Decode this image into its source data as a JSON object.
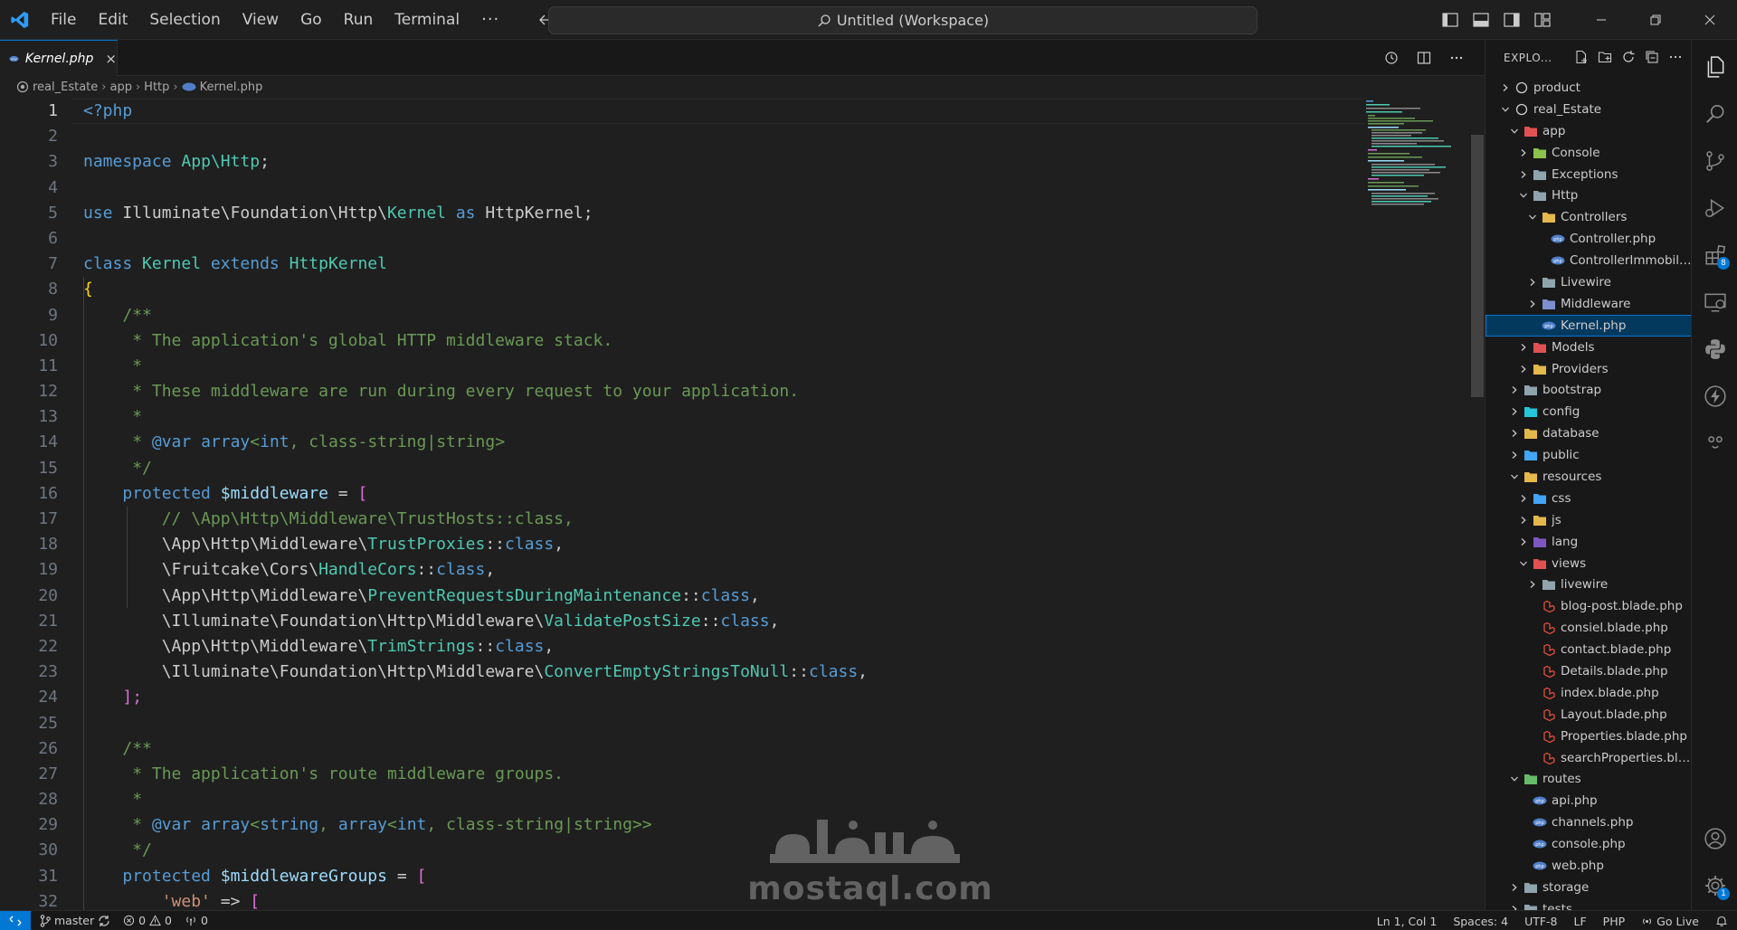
{
  "titlebar": {
    "menu": [
      "File",
      "Edit",
      "Selection",
      "View",
      "Go",
      "Run",
      "Terminal"
    ],
    "more": "···",
    "command_center": "Untitled (Workspace)"
  },
  "tab": {
    "label": "Kernel.php",
    "close": "×"
  },
  "breadcrumb": [
    "real_Estate",
    "app",
    "Http",
    "Kernel.php"
  ],
  "editor": {
    "line_numbers": [
      "1",
      "2",
      "3",
      "4",
      "5",
      "6",
      "7",
      "8",
      "9",
      "10",
      "11",
      "12",
      "13",
      "14",
      "15",
      "16",
      "17",
      "18",
      "19",
      "20",
      "21",
      "22",
      "23",
      "24",
      "25",
      "26",
      "27",
      "28",
      "29",
      "30",
      "31",
      "32"
    ],
    "active_line": 1,
    "code": {
      "l1_tag": "<?php",
      "l3_kw": "namespace",
      "l3_ns": "App\\Http",
      "l3_end": ";",
      "l5_kw": "use",
      "l5_path": "Illuminate\\Foundation\\Http\\",
      "l5_cls": "Kernel",
      "l5_as": "as",
      "l5_alias": "HttpKernel;",
      "l7_kw": "class",
      "l7_name": "Kernel",
      "l7_ext": "extends",
      "l7_parent": "HttpKernel",
      "l8_brace": "{",
      "l9": "/**",
      "l10": " * The application's global HTTP middleware stack.",
      "l11": " *",
      "l12": " * These middleware are run during every request to your application.",
      "l13": " *",
      "l14_a": " * ",
      "l14_var": "@var",
      "l14_type1": "array",
      "l14_b": "<",
      "l14_type2": "int",
      "l14_c": ", class-string|",
      "l14_type3": "string",
      "l14_d": ">",
      "l15": " */",
      "l16_kw": "protected",
      "l16_var": "$middleware",
      "l16_eq": " = ",
      "l16_br": "[",
      "l17": "// \\App\\Http\\Middleware\\TrustHosts::class,",
      "l18_p": "\\App\\Http\\Middleware\\",
      "l18_c": "TrustProxies",
      "l19_p": "\\Fruitcake\\Cors\\",
      "l19_c": "HandleCors",
      "l20_p": "\\App\\Http\\Middleware\\",
      "l20_c": "PreventRequestsDuringMaintenance",
      "l21_p": "\\Illuminate\\Foundation\\Http\\Middleware\\",
      "l21_c": "ValidatePostSize",
      "l22_p": "\\App\\Http\\Middleware\\",
      "l22_c": "TrimStrings",
      "l23_p": "\\Illuminate\\Foundation\\Http\\Middleware\\",
      "l23_c": "ConvertEmptyStringsToNull",
      "dcolon": "::",
      "class_kw": "class",
      "comma": ",",
      "l24": "];",
      "l26": "/**",
      "l27": " * The application's route middleware groups.",
      "l28": " *",
      "l29_a": " * ",
      "l29_var": "@var",
      "l29_type1": "array",
      "l29_b": "<",
      "l29_type2": "string",
      "l29_c": ", ",
      "l29_type3": "array",
      "l29_d": "<",
      "l29_type4": "int",
      "l29_e": ", class-string|",
      "l29_type5": "string",
      "l29_f": ">>",
      "l30": " */",
      "l31_kw": "protected",
      "l31_var": "$middlewareGroups",
      "l31_eq": " = ",
      "l31_br": "[",
      "l32_str": "'web'",
      "l32_arrow": " => ",
      "l32_br": "["
    }
  },
  "explorer": {
    "title": "EXPLO...",
    "tree": [
      {
        "label": "product",
        "depth": 0,
        "kind": "root",
        "expanded": false
      },
      {
        "label": "real_Estate",
        "depth": 0,
        "kind": "root",
        "expanded": true
      },
      {
        "label": "app",
        "depth": 1,
        "kind": "folder-app",
        "expanded": true
      },
      {
        "label": "Console",
        "depth": 2,
        "kind": "folder-console",
        "expanded": false
      },
      {
        "label": "Exceptions",
        "depth": 2,
        "kind": "folder",
        "expanded": false
      },
      {
        "label": "Http",
        "depth": 2,
        "kind": "folder",
        "expanded": true
      },
      {
        "label": "Controllers",
        "depth": 3,
        "kind": "folder-yellow",
        "expanded": true
      },
      {
        "label": "Controller.php",
        "depth": 4,
        "kind": "php"
      },
      {
        "label": "ControllerImmobilie...",
        "depth": 4,
        "kind": "php"
      },
      {
        "label": "Livewire",
        "depth": 3,
        "kind": "folder",
        "expanded": false
      },
      {
        "label": "Middleware",
        "depth": 3,
        "kind": "folder-mid",
        "expanded": false
      },
      {
        "label": "Kernel.php",
        "depth": 3,
        "kind": "php",
        "selected": true
      },
      {
        "label": "Models",
        "depth": 2,
        "kind": "folder-red",
        "expanded": false
      },
      {
        "label": "Providers",
        "depth": 2,
        "kind": "folder-yellow",
        "expanded": false
      },
      {
        "label": "bootstrap",
        "depth": 1,
        "kind": "folder",
        "expanded": false
      },
      {
        "label": "config",
        "depth": 1,
        "kind": "folder-config",
        "expanded": false
      },
      {
        "label": "database",
        "depth": 1,
        "kind": "folder-yellow",
        "expanded": false
      },
      {
        "label": "public",
        "depth": 1,
        "kind": "folder-blue",
        "expanded": false
      },
      {
        "label": "resources",
        "depth": 1,
        "kind": "folder-yellow",
        "expanded": true
      },
      {
        "label": "css",
        "depth": 2,
        "kind": "folder-blue",
        "expanded": false
      },
      {
        "label": "js",
        "depth": 2,
        "kind": "folder-yellow",
        "expanded": false
      },
      {
        "label": "lang",
        "depth": 2,
        "kind": "folder-lang",
        "expanded": false
      },
      {
        "label": "views",
        "depth": 2,
        "kind": "folder-red",
        "expanded": true
      },
      {
        "label": "livewire",
        "depth": 3,
        "kind": "folder",
        "expanded": false
      },
      {
        "label": "blog-post.blade.php",
        "depth": 3,
        "kind": "blade"
      },
      {
        "label": "consiel.blade.php",
        "depth": 3,
        "kind": "blade"
      },
      {
        "label": "contact.blade.php",
        "depth": 3,
        "kind": "blade"
      },
      {
        "label": "Details.blade.php",
        "depth": 3,
        "kind": "blade"
      },
      {
        "label": "index.blade.php",
        "depth": 3,
        "kind": "blade"
      },
      {
        "label": "Layout.blade.php",
        "depth": 3,
        "kind": "blade"
      },
      {
        "label": "Properties.blade.php",
        "depth": 3,
        "kind": "blade"
      },
      {
        "label": "searchProperties.blad...",
        "depth": 3,
        "kind": "blade"
      },
      {
        "label": "routes",
        "depth": 1,
        "kind": "folder-green",
        "expanded": true
      },
      {
        "label": "api.php",
        "depth": 2,
        "kind": "php"
      },
      {
        "label": "channels.php",
        "depth": 2,
        "kind": "php"
      },
      {
        "label": "console.php",
        "depth": 2,
        "kind": "php"
      },
      {
        "label": "web.php",
        "depth": 2,
        "kind": "php"
      },
      {
        "label": "storage",
        "depth": 1,
        "kind": "folder",
        "expanded": false
      },
      {
        "label": "tests",
        "depth": 1,
        "kind": "folder",
        "expanded": false
      }
    ]
  },
  "activity": {
    "extensions_badge": "8",
    "settings_badge": "1"
  },
  "statusbar": {
    "branch": "master",
    "errors": "0",
    "warnings": "0",
    "ports": "0",
    "position": "Ln 1, Col 1",
    "spaces": "Spaces: 4",
    "encoding": "UTF-8",
    "eol": "LF",
    "language": "PHP",
    "golive": "Go Live"
  },
  "watermark": {
    "latin": "mostaql.com"
  },
  "colors": {
    "accent": "#0078d4",
    "keyword": "#569cd6",
    "type": "#4ec9b0",
    "comment": "#6a9955",
    "variable": "#9cdcfe",
    "string": "#ce9178"
  }
}
